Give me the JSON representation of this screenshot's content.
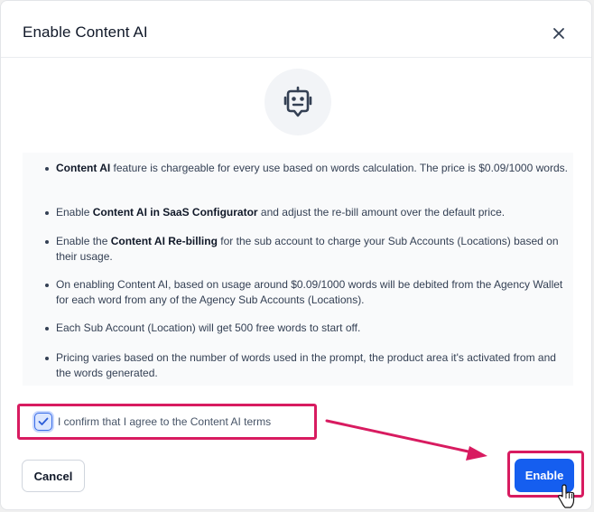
{
  "dialog": {
    "title": "Enable Content AI",
    "close_icon": "close-icon",
    "robot_icon": "robot-icon"
  },
  "info_items": [
    {
      "bold": "Content AI",
      "rest": " feature is chargeable for every use based on words calculation. The price is $0.09/1000 words."
    },
    {
      "pre": "Enable ",
      "bold": "Content AI in SaaS Configurator",
      "rest": " and adjust the re-bill amount over the default price."
    },
    {
      "pre": "Enable the ",
      "bold": "Content AI Re-billing",
      "rest": " for the sub account to charge your Sub Accounts (Locations) based on their usage."
    },
    {
      "pre": "On enabling Content AI, based on usage around $0.09/1000 words will be debited from the Agency Wallet for each word from any of the Agency Sub Accounts (Locations).",
      "bold": "",
      "rest": ""
    },
    {
      "pre": "Each Sub Account (Location) will get 500 free words to start off.",
      "bold": "",
      "rest": ""
    },
    {
      "pre": "Pricing varies based on the number of words used in the prompt, the product area it's activated from and the words generated.",
      "bold": "",
      "rest": ""
    }
  ],
  "confirm": {
    "label": "I confirm that I agree to the Content AI terms",
    "checked": true
  },
  "footer": {
    "cancel_label": "Cancel",
    "enable_label": "Enable"
  },
  "colors": {
    "accent": "#155eef",
    "highlight": "#d81b60"
  }
}
